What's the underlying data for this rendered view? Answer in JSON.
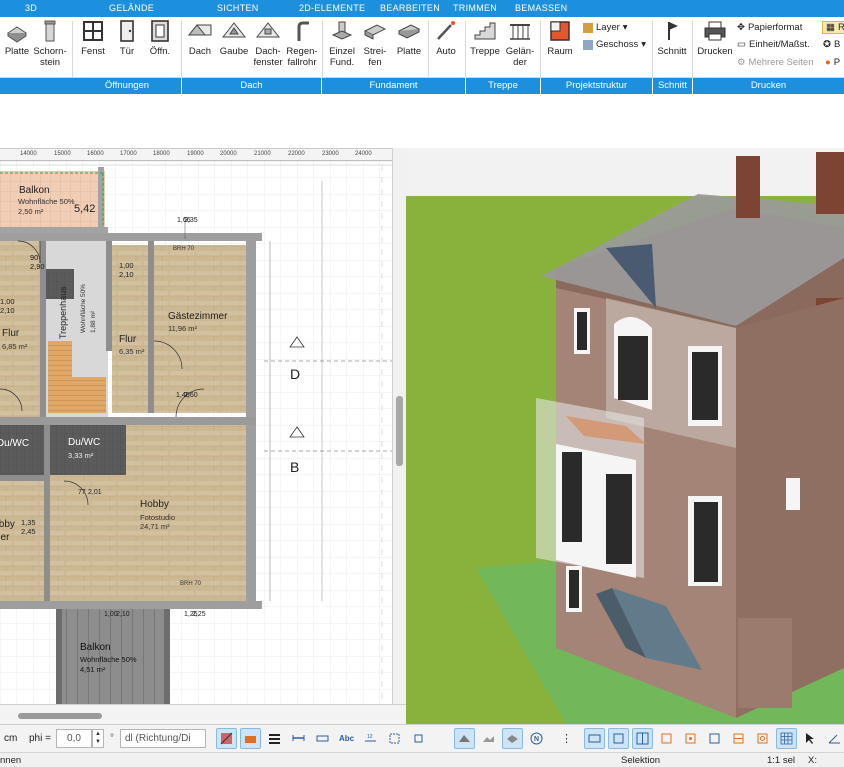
{
  "ribbon_tabs": [
    "3D",
    "GELÄNDE",
    "SICHTEN",
    "2D-ELEMENTE",
    "BEARBEITEN",
    "TRIMMEN",
    "BEMASSEN"
  ],
  "ribbon": {
    "buttons": {
      "platte1": [
        "Platte",
        ""
      ],
      "schornstein": [
        "Schorn-",
        "stein"
      ],
      "fenster": [
        "Fenst",
        ""
      ],
      "tuer": [
        "Tür",
        ""
      ],
      "oeffnung": [
        "Öffn.",
        ""
      ],
      "dach": [
        "Dach",
        ""
      ],
      "gaube": [
        "Gaube",
        ""
      ],
      "dachfenster": [
        "Dach-",
        "fenster"
      ],
      "regenfallrohr": [
        "Regen-",
        "fallrohr"
      ],
      "einzelfund": [
        "Einzel",
        "Fund."
      ],
      "streifen": [
        "Strei-",
        "fen"
      ],
      "platte2": [
        "Platte",
        ""
      ],
      "auto": [
        "Auto",
        ""
      ],
      "treppe": [
        "Treppe",
        ""
      ],
      "gelaender": [
        "Gelän-",
        "der"
      ],
      "raum": [
        "Raum",
        ""
      ],
      "schnitt": [
        "Schnitt",
        ""
      ],
      "drucken": [
        "Drucken",
        ""
      ]
    },
    "small": {
      "layer": "Layer",
      "geschoss": "Geschoss",
      "papierformat": "Papierformat",
      "einheit": "Einheit/Maßst.",
      "mehrere_seiten": "Mehrere Seiten",
      "r_label": "R",
      "b_label": "B",
      "p_label": "P"
    },
    "groups": [
      "Öffnungen",
      "Dach",
      "Fundament",
      "Treppe",
      "Projektstruktur",
      "Schnitt",
      "Drucken"
    ]
  },
  "ruler_ticks": [
    "14000",
    "15000",
    "16000",
    "17000",
    "18000",
    "19000",
    "20000",
    "21000",
    "22000",
    "23000",
    "24000"
  ],
  "plan": {
    "balkon_top": {
      "name": "Balkon",
      "sub": "Wohnfläche  50%",
      "area": "2,50 m²",
      "dim": "5,42"
    },
    "gastezimmer": {
      "name": "Gästezimmer",
      "area": "11,96 m²"
    },
    "flur_left": {
      "name": "Flur",
      "area": "6,85 m²"
    },
    "flur_mid": {
      "name": "Flur",
      "area": "6,35 m²"
    },
    "treppenhaus": {
      "name": "Treppenhaus",
      "sub": "Wohnfläche  50%",
      "area": "1,88 m²"
    },
    "dwc_left": {
      "name": "Du/WC"
    },
    "dwc": {
      "name": "Du/WC",
      "area": "3,33 m²"
    },
    "hobby": {
      "name": "Hobby",
      "sub": "Fotostudio",
      "area": "24,71 m²"
    },
    "hobby_left": {
      "name": "Hobby",
      "sub": "..er"
    },
    "balkon_bottom": {
      "name": "Balkon",
      "sub": "Wohnfläche  50%",
      "area": "4,51 m²"
    },
    "brh1": "BRH 70",
    "brh2": "BRH 70",
    "section_d": "D",
    "section_b": "B",
    "dims": {
      "d1": "1,00",
      "d2": "2,10",
      "d3": "90",
      "d4": "2,90",
      "d5": "1,00",
      "d6": "2,10",
      "d7": "1,66",
      "d8": "2,35",
      "d9": "1,35",
      "d10": "2,45",
      "d11": "1,25",
      "d12": "2,25",
      "d13": "1,00",
      "d14": "2,10",
      "d15": "1,40",
      "d16": "2,60",
      "d17": "77",
      "d18": "2,01"
    }
  },
  "toolbar": {
    "unit": "cm",
    "phi_label": "phi =",
    "phi_value": "0,0",
    "dl_value": "dl (Richtung/Di"
  },
  "status": {
    "left": "nnen",
    "mode": "Selektion",
    "scale": "1:1 sel",
    "x": "X:"
  }
}
